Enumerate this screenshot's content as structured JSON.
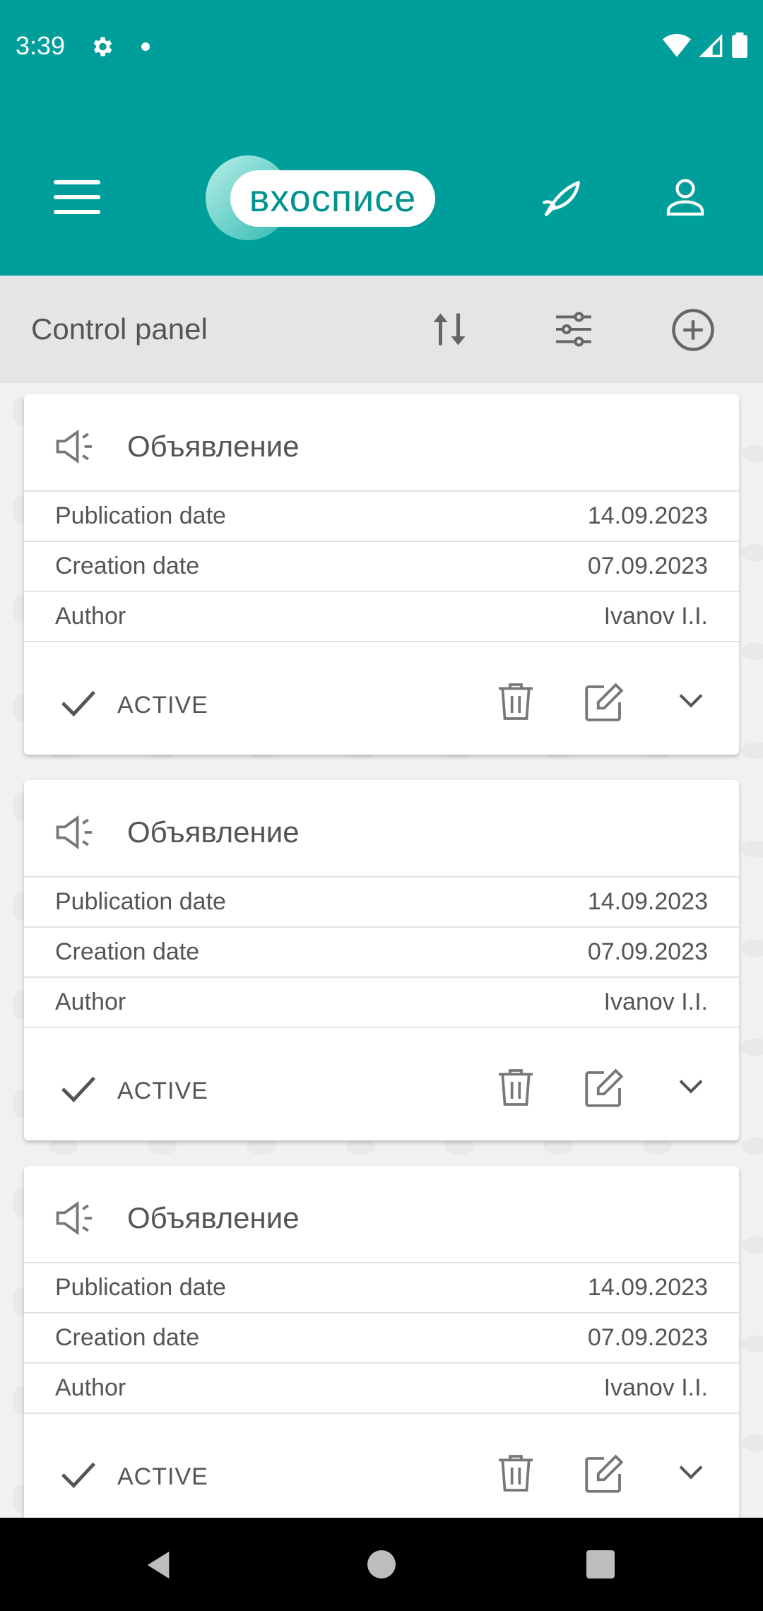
{
  "status_bar": {
    "time": "3:39"
  },
  "app": {
    "logo_text": "вхосписе",
    "brand_color": "#009e9a"
  },
  "toolbar": {
    "title": "Control panel"
  },
  "cards": [
    {
      "title": "Объявление",
      "rows": [
        {
          "label": "Publication date",
          "value": "14.09.2023"
        },
        {
          "label": "Creation date",
          "value": "07.09.2023"
        },
        {
          "label": "Author",
          "value": "Ivanov I.I."
        }
      ],
      "status": "ACTIVE"
    },
    {
      "title": "Объявление",
      "rows": [
        {
          "label": "Publication date",
          "value": "14.09.2023"
        },
        {
          "label": "Creation date",
          "value": "07.09.2023"
        },
        {
          "label": "Author",
          "value": "Ivanov I.I."
        }
      ],
      "status": "ACTIVE"
    },
    {
      "title": "Объявление",
      "rows": [
        {
          "label": "Publication date",
          "value": "14.09.2023"
        },
        {
          "label": "Creation date",
          "value": "07.09.2023"
        },
        {
          "label": "Author",
          "value": "Ivanov I.I."
        }
      ],
      "status": "ACTIVE"
    }
  ]
}
